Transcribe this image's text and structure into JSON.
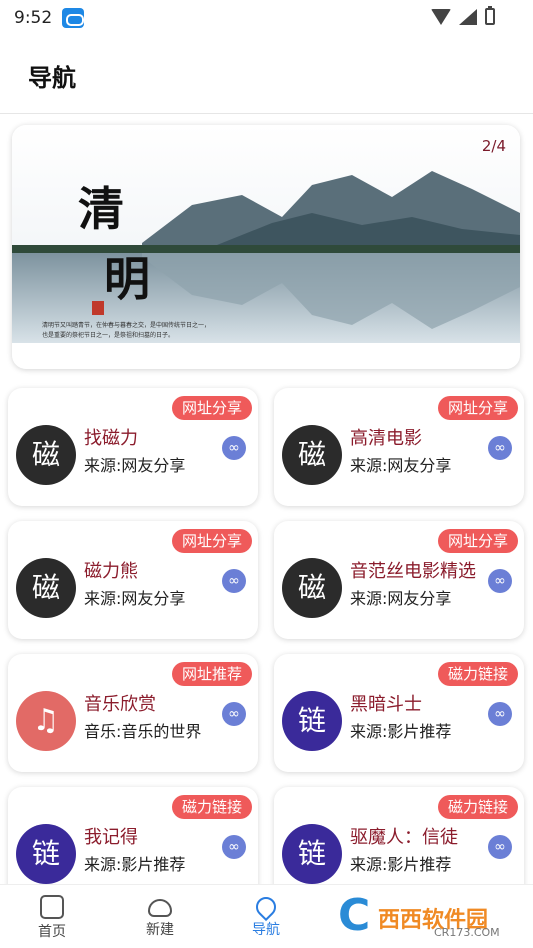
{
  "status_bar": {
    "time": "9:52"
  },
  "header": {
    "title": "导航"
  },
  "banner": {
    "counter": "2/4",
    "char1": "清",
    "char2": "明",
    "poem": "清明节又叫踏青节，在仲春与暮春之交，是中国传统节日之一，也是重要的祭祀节日之一，是祭祖和扫墓的日子。"
  },
  "cards": [
    {
      "tag": "网址分享",
      "logo": "磁",
      "name": "找磁力",
      "source": "来源:网友分享",
      "link_icon": "link-icon"
    },
    {
      "tag": "网址分享",
      "logo": "磁",
      "name": "高清电影",
      "source": "来源:网友分享",
      "link_icon": "link-icon"
    },
    {
      "tag": "网址分享",
      "logo": "磁",
      "name": "磁力熊",
      "source": "来源:网友分享",
      "link_icon": "link-icon"
    },
    {
      "tag": "网址分享",
      "logo": "磁",
      "name": "音范丝电影精选",
      "source": "来源:网友分享",
      "link_icon": "link-icon"
    },
    {
      "tag": "网址推荐",
      "logo": "♫",
      "name": "音乐欣赏",
      "source": "音乐:音乐的世界",
      "link_icon": "link-icon"
    },
    {
      "tag": "磁力链接",
      "logo": "链",
      "name": "黑暗斗士",
      "source": "来源:影片推荐",
      "link_icon": "link-icon"
    },
    {
      "tag": "磁力链接",
      "logo": "链",
      "name": "我记得",
      "source": "来源:影片推荐",
      "link_icon": "link-icon"
    },
    {
      "tag": "磁力链接",
      "logo": "链",
      "name": "驱魔人：信徒",
      "source": "来源:影片推荐",
      "link_icon": "link-icon"
    }
  ],
  "bottom_nav": {
    "home": "首页",
    "new": "新建",
    "nav": "导航"
  },
  "watermark": {
    "brand": "西西软件园",
    "site": "CR173.COM"
  },
  "colors": {
    "tag_bg": "#ef5a5a",
    "accent_blue": "#2a7de1",
    "name_red": "#8b1c2c",
    "link_bg": "#6b7fd6"
  }
}
